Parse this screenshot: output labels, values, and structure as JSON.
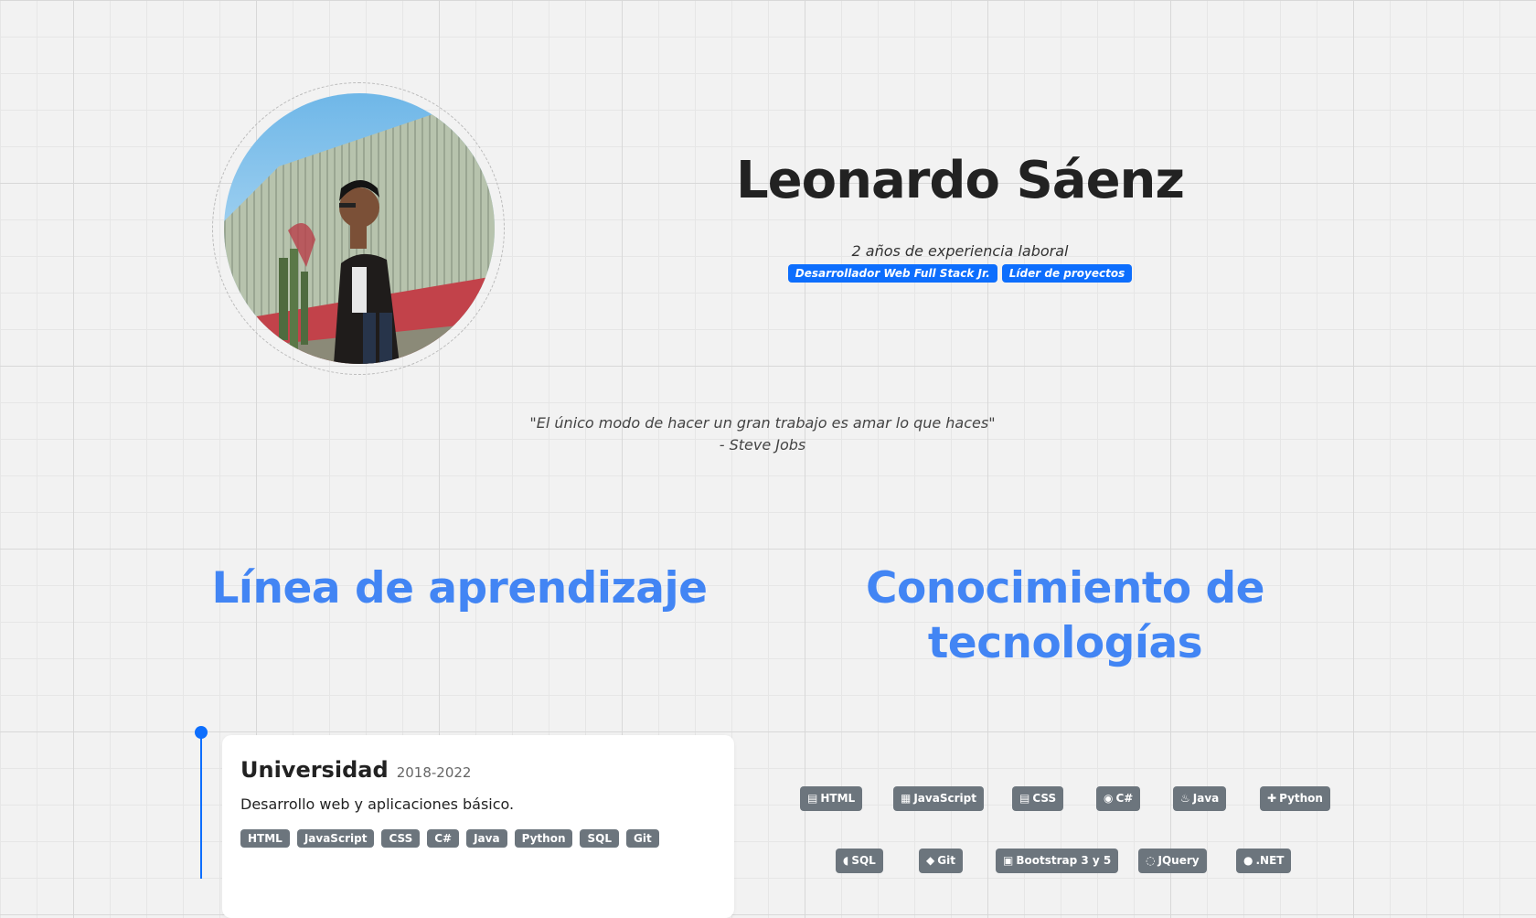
{
  "profile": {
    "name": "Leonardo Sáenz",
    "experience": "2 años de experiencia laboral",
    "roles": [
      "Desarrollador Web Full Stack Jr.",
      "Líder de proyectos"
    ]
  },
  "quote": {
    "text": "\"El único modo de hacer un gran trabajo es amar lo que haces\"",
    "author": "- Steve Jobs"
  },
  "sections": {
    "learning_title": "Línea de aprendizaje",
    "tech_title": "Conocimiento de tecnologías"
  },
  "timeline": [
    {
      "title": "Universidad",
      "years": "2018-2022",
      "description": "Desarrollo web y aplicaciones básico.",
      "tags": [
        "HTML",
        "JavaScript",
        "CSS",
        "C#",
        "Java",
        "Python",
        "SQL",
        "Git"
      ]
    }
  ],
  "technologies": [
    {
      "label": "HTML",
      "icon": "html5-icon",
      "glyph": "▤"
    },
    {
      "label": "JavaScript",
      "icon": "javascript-icon",
      "glyph": "▦"
    },
    {
      "label": "CSS",
      "icon": "css3-icon",
      "glyph": "▤"
    },
    {
      "label": "C#",
      "icon": "csharp-icon",
      "glyph": "◉"
    },
    {
      "label": "Java",
      "icon": "java-icon",
      "glyph": "♨"
    },
    {
      "label": "Python",
      "icon": "python-icon",
      "glyph": "✚"
    },
    {
      "label": "SQL",
      "icon": "database-icon",
      "glyph": "◖"
    },
    {
      "label": "Git",
      "icon": "git-icon",
      "glyph": "◆"
    },
    {
      "label": "Bootstrap 3 y 5",
      "icon": "bootstrap-icon",
      "glyph": "▣"
    },
    {
      "label": "JQuery",
      "icon": "jquery-icon",
      "glyph": "◌"
    },
    {
      "label": ".NET",
      "icon": "dotnet-icon",
      "glyph": "●"
    }
  ],
  "colors": {
    "accent": "#0d6efd",
    "heading": "#4285f4",
    "badge": "#6c757d",
    "background": "#f2f2f2"
  }
}
